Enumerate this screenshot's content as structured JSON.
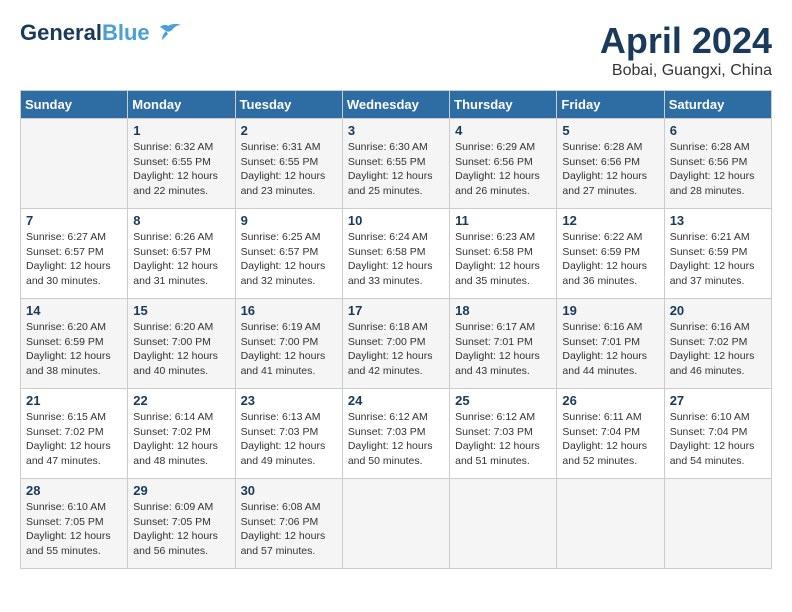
{
  "header": {
    "logo_general": "General",
    "logo_blue": "Blue",
    "month": "April 2024",
    "location": "Bobai, Guangxi, China"
  },
  "days_of_week": [
    "Sunday",
    "Monday",
    "Tuesday",
    "Wednesday",
    "Thursday",
    "Friday",
    "Saturday"
  ],
  "weeks": [
    [
      {
        "day": "",
        "info": ""
      },
      {
        "day": "1",
        "info": "Sunrise: 6:32 AM\nSunset: 6:55 PM\nDaylight: 12 hours\nand 22 minutes."
      },
      {
        "day": "2",
        "info": "Sunrise: 6:31 AM\nSunset: 6:55 PM\nDaylight: 12 hours\nand 23 minutes."
      },
      {
        "day": "3",
        "info": "Sunrise: 6:30 AM\nSunset: 6:55 PM\nDaylight: 12 hours\nand 25 minutes."
      },
      {
        "day": "4",
        "info": "Sunrise: 6:29 AM\nSunset: 6:56 PM\nDaylight: 12 hours\nand 26 minutes."
      },
      {
        "day": "5",
        "info": "Sunrise: 6:28 AM\nSunset: 6:56 PM\nDaylight: 12 hours\nand 27 minutes."
      },
      {
        "day": "6",
        "info": "Sunrise: 6:28 AM\nSunset: 6:56 PM\nDaylight: 12 hours\nand 28 minutes."
      }
    ],
    [
      {
        "day": "7",
        "info": "Sunrise: 6:27 AM\nSunset: 6:57 PM\nDaylight: 12 hours\nand 30 minutes."
      },
      {
        "day": "8",
        "info": "Sunrise: 6:26 AM\nSunset: 6:57 PM\nDaylight: 12 hours\nand 31 minutes."
      },
      {
        "day": "9",
        "info": "Sunrise: 6:25 AM\nSunset: 6:57 PM\nDaylight: 12 hours\nand 32 minutes."
      },
      {
        "day": "10",
        "info": "Sunrise: 6:24 AM\nSunset: 6:58 PM\nDaylight: 12 hours\nand 33 minutes."
      },
      {
        "day": "11",
        "info": "Sunrise: 6:23 AM\nSunset: 6:58 PM\nDaylight: 12 hours\nand 35 minutes."
      },
      {
        "day": "12",
        "info": "Sunrise: 6:22 AM\nSunset: 6:59 PM\nDaylight: 12 hours\nand 36 minutes."
      },
      {
        "day": "13",
        "info": "Sunrise: 6:21 AM\nSunset: 6:59 PM\nDaylight: 12 hours\nand 37 minutes."
      }
    ],
    [
      {
        "day": "14",
        "info": "Sunrise: 6:20 AM\nSunset: 6:59 PM\nDaylight: 12 hours\nand 38 minutes."
      },
      {
        "day": "15",
        "info": "Sunrise: 6:20 AM\nSunset: 7:00 PM\nDaylight: 12 hours\nand 40 minutes."
      },
      {
        "day": "16",
        "info": "Sunrise: 6:19 AM\nSunset: 7:00 PM\nDaylight: 12 hours\nand 41 minutes."
      },
      {
        "day": "17",
        "info": "Sunrise: 6:18 AM\nSunset: 7:00 PM\nDaylight: 12 hours\nand 42 minutes."
      },
      {
        "day": "18",
        "info": "Sunrise: 6:17 AM\nSunset: 7:01 PM\nDaylight: 12 hours\nand 43 minutes."
      },
      {
        "day": "19",
        "info": "Sunrise: 6:16 AM\nSunset: 7:01 PM\nDaylight: 12 hours\nand 44 minutes."
      },
      {
        "day": "20",
        "info": "Sunrise: 6:16 AM\nSunset: 7:02 PM\nDaylight: 12 hours\nand 46 minutes."
      }
    ],
    [
      {
        "day": "21",
        "info": "Sunrise: 6:15 AM\nSunset: 7:02 PM\nDaylight: 12 hours\nand 47 minutes."
      },
      {
        "day": "22",
        "info": "Sunrise: 6:14 AM\nSunset: 7:02 PM\nDaylight: 12 hours\nand 48 minutes."
      },
      {
        "day": "23",
        "info": "Sunrise: 6:13 AM\nSunset: 7:03 PM\nDaylight: 12 hours\nand 49 minutes."
      },
      {
        "day": "24",
        "info": "Sunrise: 6:12 AM\nSunset: 7:03 PM\nDaylight: 12 hours\nand 50 minutes."
      },
      {
        "day": "25",
        "info": "Sunrise: 6:12 AM\nSunset: 7:03 PM\nDaylight: 12 hours\nand 51 minutes."
      },
      {
        "day": "26",
        "info": "Sunrise: 6:11 AM\nSunset: 7:04 PM\nDaylight: 12 hours\nand 52 minutes."
      },
      {
        "day": "27",
        "info": "Sunrise: 6:10 AM\nSunset: 7:04 PM\nDaylight: 12 hours\nand 54 minutes."
      }
    ],
    [
      {
        "day": "28",
        "info": "Sunrise: 6:10 AM\nSunset: 7:05 PM\nDaylight: 12 hours\nand 55 minutes."
      },
      {
        "day": "29",
        "info": "Sunrise: 6:09 AM\nSunset: 7:05 PM\nDaylight: 12 hours\nand 56 minutes."
      },
      {
        "day": "30",
        "info": "Sunrise: 6:08 AM\nSunset: 7:06 PM\nDaylight: 12 hours\nand 57 minutes."
      },
      {
        "day": "",
        "info": ""
      },
      {
        "day": "",
        "info": ""
      },
      {
        "day": "",
        "info": ""
      },
      {
        "day": "",
        "info": ""
      }
    ]
  ]
}
